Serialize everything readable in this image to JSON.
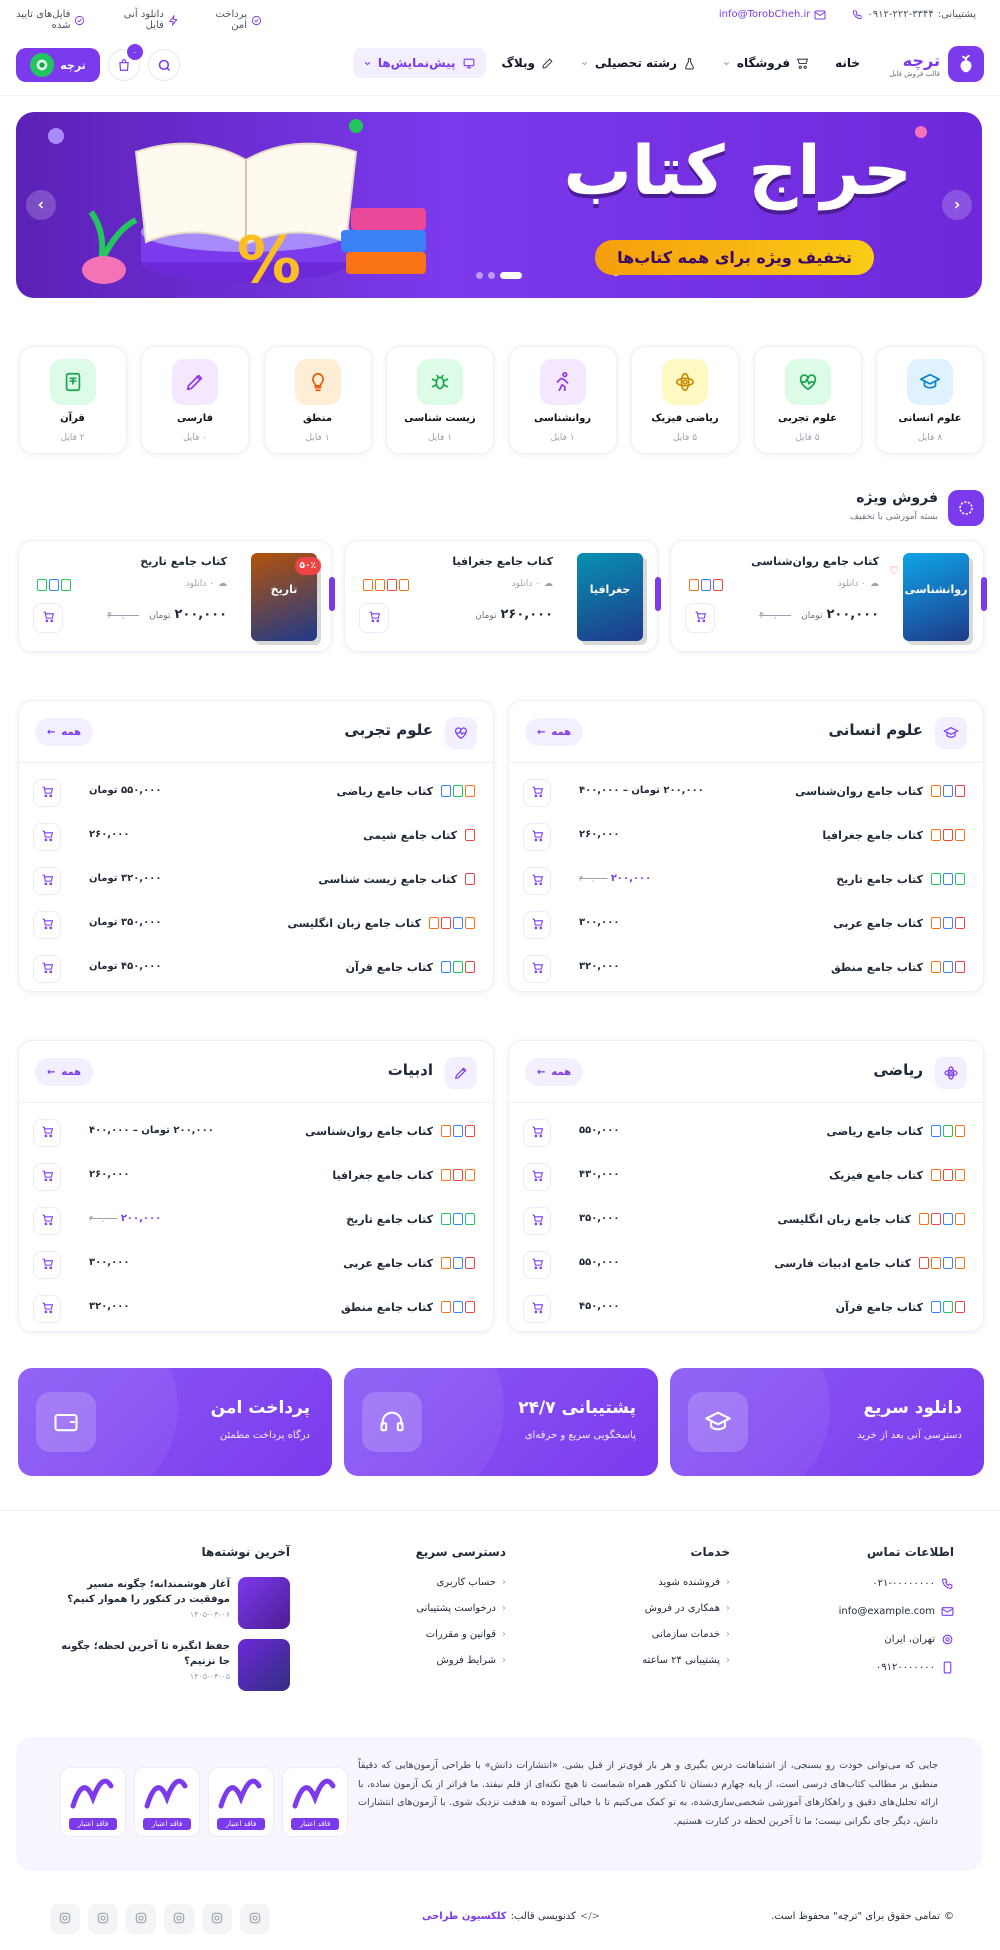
{
  "topbar": {
    "support_label": "پشتیبانی:",
    "support_phone": "۰۹۱۲-۲۲۲-۳۳۴۴",
    "email": "info@TorobCheh.ir",
    "badges": [
      "پرداخت امن",
      "دانلود آنی فایل",
      "فایل‌های تایید شده"
    ]
  },
  "header": {
    "logo_title": "ترچه",
    "logo_subtitle": "قالب فروش فایل",
    "nav": [
      {
        "label": "خانه",
        "icon": "home-icon"
      },
      {
        "label": "فروشگاه",
        "icon": "store-icon"
      },
      {
        "label": "رشته تحصیلی",
        "icon": "flask-icon"
      },
      {
        "label": "وبلاگ",
        "icon": "edit-icon"
      },
      {
        "label": "پیش‌نمایش‌ها",
        "icon": "monitor-icon"
      }
    ],
    "cart_count": "۰",
    "user_label": "ترچه"
  },
  "banner": {
    "title": "حراج کتاب",
    "subtitle": "تخفیف ویژه برای همه کتاب‌ها",
    "percent": "%"
  },
  "categories": [
    {
      "name": "علوم انسانی",
      "count": "۸ فایل",
      "bg": "#e0f2fe",
      "fg": "#0284c7",
      "icon": "graduation-icon"
    },
    {
      "name": "علوم تجربی",
      "count": "۵ فایل",
      "bg": "#dcfce7",
      "fg": "#16a34a",
      "icon": "heartbeat-icon"
    },
    {
      "name": "ریاضی فیزیک",
      "count": "۵ فایل",
      "bg": "#fef9c3",
      "fg": "#ca8a04",
      "icon": "atom-icon"
    },
    {
      "name": "روانشناسی",
      "count": "۱ فایل",
      "bg": "#f3e8ff",
      "fg": "#9333ea",
      "icon": "person-run-icon"
    },
    {
      "name": "زیست شناسی",
      "count": "۱ فایل",
      "bg": "#dcfce7",
      "fg": "#16a34a",
      "icon": "bug-icon"
    },
    {
      "name": "منطق",
      "count": "۱ فایل",
      "bg": "#ffedd5",
      "fg": "#ea580c",
      "icon": "bulb-icon"
    },
    {
      "name": "فارسی",
      "count": "۰ فایل",
      "bg": "#f3e8ff",
      "fg": "#9333ea",
      "icon": "pen-icon"
    },
    {
      "name": "قرآن",
      "count": "۲ فایل",
      "bg": "#dcfce7",
      "fg": "#16a34a",
      "icon": "book-icon"
    }
  ],
  "special": {
    "title": "فروش ویژه",
    "subtitle": "بسته آموزشی با تخفیف",
    "products": [
      {
        "title": "کتاب جامع روان‌شناسی",
        "downloads": "۰ دانلود",
        "price": "۲۰۰,۰۰۰",
        "price_old": "۴۰۰,۰۰۰",
        "unit": "تومان",
        "cover": "#0ea5e9",
        "cover_text": "روانشناسی",
        "files": [
          "pdf",
          "doc",
          "ppt"
        ]
      },
      {
        "title": "کتاب جامع جغرافیا",
        "downloads": "۰ دانلود",
        "price": "۲۶۰,۰۰۰",
        "price_old": "",
        "unit": "تومان",
        "cover": "#0891b2",
        "cover_text": "جغرافیا",
        "files": [
          "ppt",
          "pdf",
          "ppt",
          "ppt"
        ]
      },
      {
        "title": "کتاب جامع تاریخ",
        "downloads": "۰ دانلود",
        "price": "۲۰۰,۰۰۰",
        "price_old": "۴۰۰,۰۰۰",
        "unit": "تومان",
        "cover": "#b45309",
        "cover_text": "تاریخ",
        "discount": "۵۰٪",
        "files": [
          "xls",
          "doc",
          "xls"
        ]
      }
    ]
  },
  "sections": [
    {
      "title": "علوم انسانی",
      "all": "همه",
      "icon": "graduation-icon",
      "items": [
        {
          "name": "کتاب جامع روان‌شناسی",
          "price": "۲۰۰,۰۰۰ تومان – ۴۰۰,۰۰۰",
          "old": "",
          "files": [
            "pdf",
            "doc",
            "ppt"
          ]
        },
        {
          "name": "کتاب جامع جغرافیا",
          "price": "۲۶۰,۰۰۰",
          "old": "",
          "files": [
            "ppt",
            "pdf",
            "ppt"
          ]
        },
        {
          "name": "کتاب جامع تاریخ",
          "price": "۲۰۰,۰۰۰",
          "old": "۴۰۰,۰۰۰",
          "files": [
            "xls",
            "doc",
            "xls"
          ]
        },
        {
          "name": "کتاب جامع عربی",
          "price": "۳۰۰,۰۰۰",
          "old": "",
          "files": [
            "pdf",
            "doc",
            "ppt"
          ]
        },
        {
          "name": "کتاب جامع منطق",
          "price": "۳۲۰,۰۰۰",
          "old": "",
          "files": [
            "pdf",
            "doc",
            "ppt"
          ]
        }
      ]
    },
    {
      "title": "علوم تجربی",
      "all": "همه",
      "icon": "heartbeat-icon",
      "items": [
        {
          "name": "کتاب جامع ریاضی",
          "price": "۵۵۰,۰۰۰ تومان",
          "old": "",
          "files": [
            "ppt",
            "xls",
            "doc"
          ]
        },
        {
          "name": "کتاب جامع شیمی",
          "price": "۲۶۰,۰۰۰",
          "old": "",
          "files": [
            "pdf"
          ]
        },
        {
          "name": "کتاب جامع زیست شناسی",
          "price": "۳۲۰,۰۰۰ تومان",
          "old": "",
          "files": [
            "pdf"
          ]
        },
        {
          "name": "کتاب جامع زبان انگلیسی",
          "price": "۳۵۰,۰۰۰ تومان",
          "old": "",
          "files": [
            "ppt",
            "doc",
            "pdf",
            "ppt"
          ]
        },
        {
          "name": "کتاب جامع قرآن",
          "price": "۴۵۰,۰۰۰ تومان",
          "old": "",
          "files": [
            "pdf",
            "xls",
            "doc"
          ]
        }
      ]
    },
    {
      "title": "ریاضی",
      "all": "همه",
      "icon": "atom-icon",
      "items": [
        {
          "name": "کتاب جامع ریاضی",
          "price": "۵۵۰,۰۰۰",
          "old": "",
          "files": [
            "ppt",
            "xls",
            "doc"
          ]
        },
        {
          "name": "کتاب جامع فیزیک",
          "price": "۴۳۰,۰۰۰",
          "old": "",
          "files": [
            "ppt",
            "pdf",
            "ppt"
          ]
        },
        {
          "name": "کتاب جامع زبان انگلیسی",
          "price": "۳۵۰,۰۰۰",
          "old": "",
          "files": [
            "ppt",
            "doc",
            "pdf",
            "ppt"
          ]
        },
        {
          "name": "کتاب جامع ادبیات فارسی",
          "price": "۵۵۰,۰۰۰",
          "old": "",
          "files": [
            "ppt",
            "doc",
            "ppt",
            "pdf"
          ]
        },
        {
          "name": "کتاب جامع قرآن",
          "price": "۴۵۰,۰۰۰",
          "old": "",
          "files": [
            "pdf",
            "xls",
            "doc"
          ]
        }
      ]
    },
    {
      "title": "ادبیات",
      "all": "همه",
      "icon": "pen-icon",
      "items": [
        {
          "name": "کتاب جامع روان‌شناسی",
          "price": "۲۰۰,۰۰۰ تومان – ۴۰۰,۰۰۰",
          "old": "",
          "files": [
            "pdf",
            "doc",
            "ppt"
          ]
        },
        {
          "name": "کتاب جامع جغرافیا",
          "price": "۲۶۰,۰۰۰",
          "old": "",
          "files": [
            "ppt",
            "pdf",
            "ppt"
          ]
        },
        {
          "name": "کتاب جامع تاریخ",
          "price": "۲۰۰,۰۰۰",
          "old": "۴۰۰,۰۰۰",
          "files": [
            "xls",
            "doc",
            "xls"
          ]
        },
        {
          "name": "کتاب جامع عربی",
          "price": "۳۰۰,۰۰۰",
          "old": "",
          "files": [
            "pdf",
            "doc",
            "ppt"
          ]
        },
        {
          "name": "کتاب جامع منطق",
          "price": "۳۲۰,۰۰۰",
          "old": "",
          "files": [
            "pdf",
            "doc",
            "ppt"
          ]
        }
      ]
    }
  ],
  "features": [
    {
      "title": "دانلود سریع",
      "subtitle": "دسترسی آنی بعد از خرید",
      "icon": "graduation-icon"
    },
    {
      "title": "پشتیبانی ۲۴/۷",
      "subtitle": "پاسخگویی سریع و حرفه‌ای",
      "icon": "headset-icon"
    },
    {
      "title": "پرداخت امن",
      "subtitle": "درگاه پرداخت مطمئن",
      "icon": "wallet-icon"
    }
  ],
  "footer": {
    "contact_title": "اطلاعات تماس",
    "contact": [
      "۰۲۱-۰۰۰۰۰۰۰۰",
      "info@example.com",
      "تهران، ایران",
      "۰۹۱۲۰۰۰۰۰۰۰"
    ],
    "services_title": "خدمات",
    "services": [
      "فروشنده شوید",
      "همکاری در فروش",
      "خدمات سازمانی",
      "پشتیبانی ۲۴ ساعته"
    ],
    "quick_title": "دسترسی سریع",
    "quick": [
      "حساب کاربری",
      "درخواست پشتیبانی",
      "قوانین و مقررات",
      "شرایط فروش"
    ],
    "blog_title": "آخرین نوشته‌ها",
    "posts": [
      {
        "title": "آغاز هوشمندانه؛ چگونه مسیر موفقیت در کنکور را هموار کنیم؟",
        "date": "۱۴۰۵-۰۴-۰۶"
      },
      {
        "title": "حفظ انگیزه تا آخرین لحظه؛ چگونه جا نزنیم؟",
        "date": "۱۴۰۵-۰۴-۰۵"
      }
    ],
    "about": "جایی که می‌توانی خودت رو بسنجی، از اشتباهاتت درس بگیری و هر بار قوی‌تر از قبل بشی. «انتشارات دانش» با طراحی آزمون‌هایی که دقیقاً منطبق بر مطالب کتاب‌های درسی است، از پایه چهارم دبستان تا کنکور همراه شماست تا هیچ نکته‌ای از قلم نیفتد. ما فراتر از یک آزمون ساده، با ارائه تحلیل‌های دقیق و راهکارهای آموزشی شخصی‌سازی‌شده، به تو کمک می‌کنیم تا با خیالی آسوده به هدفت نزدیک شوی. با آزمون‌های انتشارات دانش، دیگر جای نگرانی نیست؛ ما تا آخرین لحظه در کنارت هستیم.",
    "badge_label": "فاقد اعتبار",
    "copyright": "تمامی حقوق برای \"ترچه\" محفوظ است.",
    "credit_label": "کدنویسی قالب:",
    "credit_name": "کلکسیون طراحی"
  }
}
